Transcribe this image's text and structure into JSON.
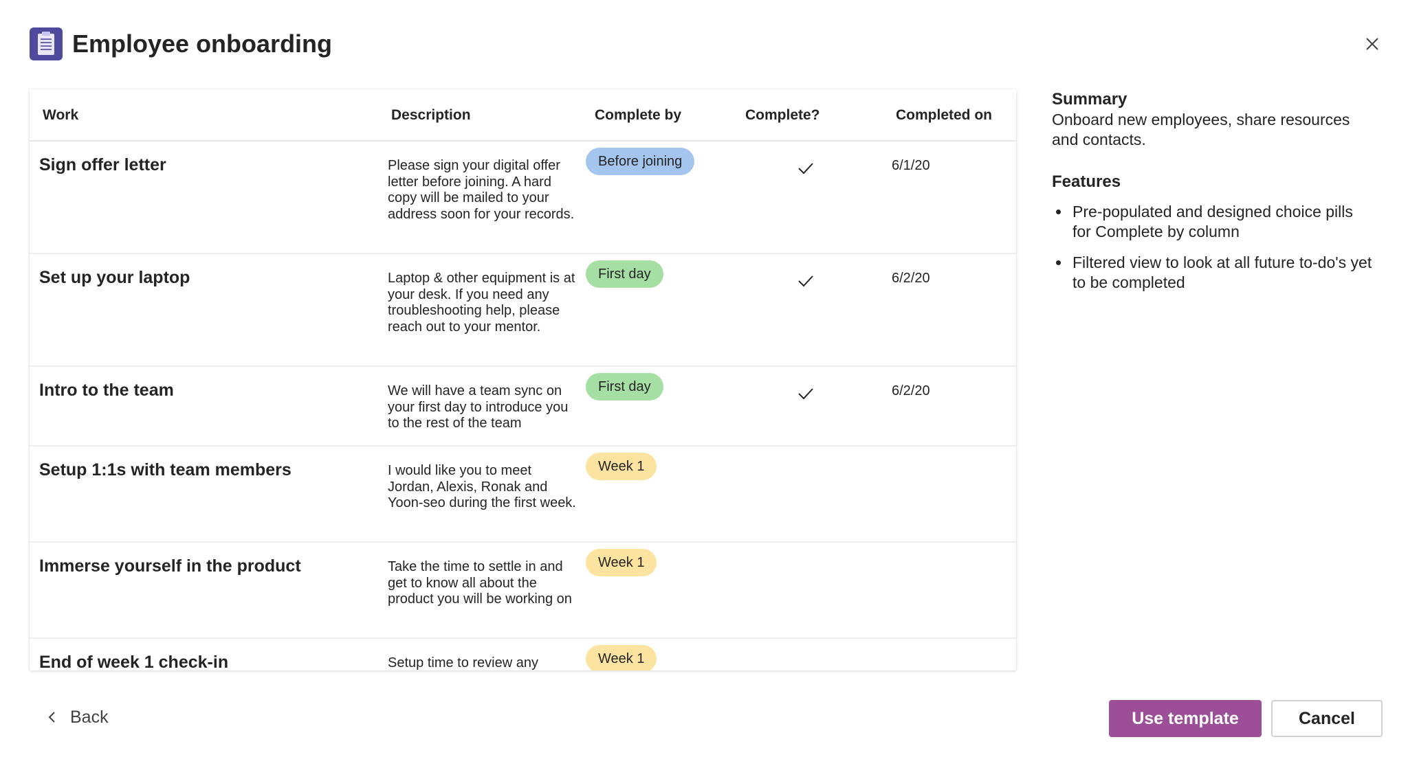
{
  "dialog": {
    "title": "Employee onboarding",
    "app_icon": "clipboard-icon",
    "close_icon": "close-icon",
    "accent_color": "#4f4a9e"
  },
  "table": {
    "columns": [
      "Work",
      "Description",
      "Complete by",
      "Complete?",
      "Completed on"
    ],
    "rows": [
      {
        "work": "Sign offer letter",
        "description": "Please sign your digital offer letter before joining. A hard copy will be mailed to your address soon for your records.",
        "complete_by": "Before joining",
        "pill_color": "#a4c6ee",
        "complete": true,
        "completed_on": "6/1/20"
      },
      {
        "work": "Set up your laptop",
        "description": "Laptop & other equipment is at your desk. If you need any troubleshooting help, please reach out to your mentor.",
        "complete_by": "First day",
        "pill_color": "#a6dfa3",
        "complete": true,
        "completed_on": "6/2/20"
      },
      {
        "work": "Intro to the team",
        "description": "We will have a team sync on your first day to introduce you to the rest of the team",
        "complete_by": "First day",
        "pill_color": "#a6dfa3",
        "complete": true,
        "completed_on": "6/2/20"
      },
      {
        "work": "Setup 1:1s with team members",
        "description": "I would like you to meet Jordan, Alexis, Ronak and Yoon-seo during the first week.",
        "complete_by": "Week 1",
        "pill_color": "#fde3a0",
        "complete": false,
        "completed_on": ""
      },
      {
        "work": "Immerse yourself in the product",
        "description": "Take the time to settle in and get to know all about the product you will be working on",
        "complete_by": "Week 1",
        "pill_color": "#fde3a0",
        "complete": false,
        "completed_on": ""
      },
      {
        "work": "End of week 1 check-in",
        "description": "Setup time to review any",
        "complete_by": "Week 1",
        "pill_color": "#fde3a0",
        "complete": false,
        "completed_on": ""
      }
    ]
  },
  "summary": {
    "heading": "Summary",
    "text": "Onboard new employees, share resources and contacts.",
    "features_heading": "Features",
    "features": [
      "Pre-populated and designed choice pills for Complete by column",
      "Filtered view to look at all future to-do's yet to be completed"
    ]
  },
  "footer": {
    "back_label": "Back",
    "back_icon": "chevron-left-icon",
    "use_template_label": "Use template",
    "use_template_color": "#9c4f96",
    "cancel_label": "Cancel"
  }
}
